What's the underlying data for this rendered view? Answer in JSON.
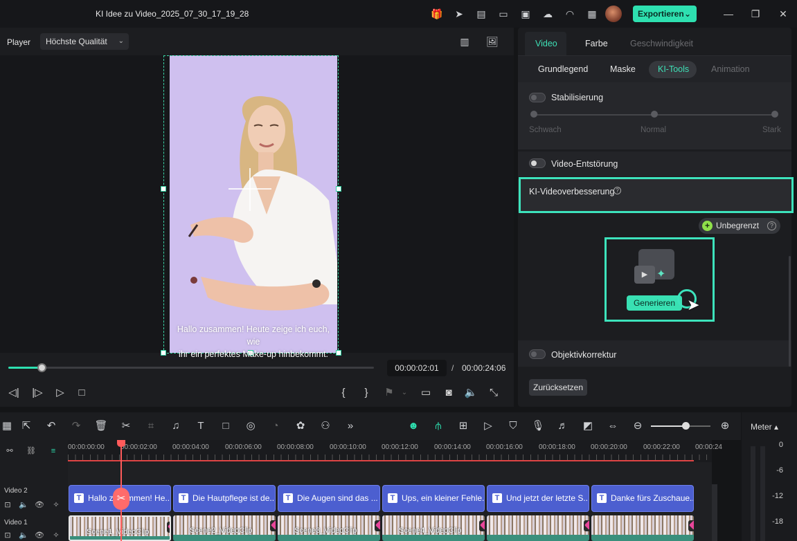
{
  "window": {
    "title": "KI Idee zu Video_2025_07_30_17_19_28",
    "export_label": "Exportieren"
  },
  "player": {
    "label": "Player",
    "quality": "Höchste Qualität",
    "subtitle_line1": "Hallo zusammen! Heute zeige ich euch, wie",
    "subtitle_line2": "ihr ein perfektes Make-up hinbekommt.",
    "time_current": "00:00:02:01",
    "time_separator": "/",
    "time_total": "00:00:24:06",
    "progress_fraction": 0.09
  },
  "props": {
    "tabs": [
      "Video",
      "Farbe",
      "Geschwindigkeit"
    ],
    "subtabs": [
      "Grundlegend",
      "Maske",
      "KI-Tools",
      "Animation"
    ],
    "stabilisierung": {
      "label": "Stabilisierung",
      "levels": [
        "Schwach",
        "Normal",
        "Stark"
      ]
    },
    "entstoerung_label": "Video-Entstörung",
    "ki_label": "KI-Videoverbesserung",
    "unbegrenzt": "Unbegrenzt",
    "generate_label": "Generieren",
    "objektiv_label": "Objektivkorrektur",
    "reset_label": "Zurücksetzen"
  },
  "timeline": {
    "ruler_labels": [
      "00:00:00:00",
      "00:00:02:00",
      "00:00:04:00",
      "00:00:06:00",
      "00:00:08:00",
      "00:00:10:00",
      "00:00:12:00",
      "00:00:14:00",
      "00:00:16:00",
      "00:00:18:00",
      "00:00:20:00",
      "00:00:22:00",
      "00:00:24"
    ],
    "meter_label": "Meter ▴",
    "meter_ticks": [
      "0",
      "-6",
      "-12",
      "-18"
    ],
    "tracks": {
      "video2": "Video 2",
      "video1": "Video 1"
    },
    "title_clips": [
      "Hallo zusammen! He...",
      "Die Hautpflege ist de...",
      "Die Augen sind das ...",
      "Ups, ein kleiner Fehle...",
      "Und jetzt der letzte S...",
      "Danke fürs Zuschaue..."
    ],
    "video_clips": [
      "Scene1_VideoClip",
      "Scene2_VideoClip",
      "Scene3_VideoClip",
      "Scene4_VideoClip",
      "",
      ""
    ]
  },
  "colors": {
    "accent": "#2ee0b0",
    "highlight_border": "#3de3bc",
    "title_clip": "#4c5fd0",
    "video_clip": "#3a8f7c",
    "playhead": "#ff5b5b",
    "video_background": "#cfc0ef"
  }
}
